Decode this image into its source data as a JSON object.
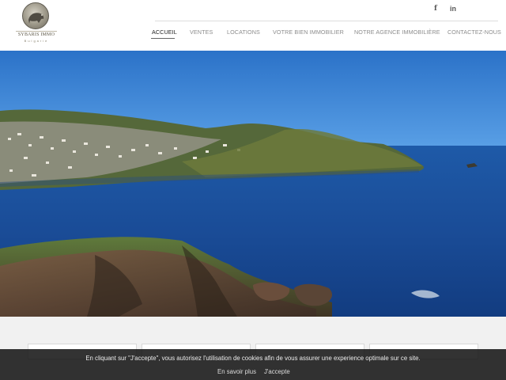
{
  "brand": {
    "name": "SYBARIS IMMO",
    "tagline": "Bulgarie"
  },
  "social": {
    "facebook": "f",
    "linkedin": "in"
  },
  "nav": {
    "items": [
      {
        "label": "ACCUEIL",
        "active": true
      },
      {
        "label": "VENTES"
      },
      {
        "label": "LOCATIONS"
      },
      {
        "label": "VOTRE BIEN IMMOBILIER"
      },
      {
        "label": "NOTRE AGENCE IMMOBILIÈRE"
      },
      {
        "label": "CONTACTEZ-NOUS"
      }
    ]
  },
  "cookie": {
    "text": "En cliquant sur \"J'accepte\", vous autorisez l'utilisation de cookies afin de vous assurer une experience optimale sur ce site.",
    "learn_more": "En savoir plus",
    "accept": "J'accepte"
  },
  "colors": {
    "header_bg": "#ffffff",
    "active_nav": "#222222",
    "nav": "#8c8c8c",
    "sea": "#1d4f9e",
    "sky": "#2e7ad0"
  }
}
